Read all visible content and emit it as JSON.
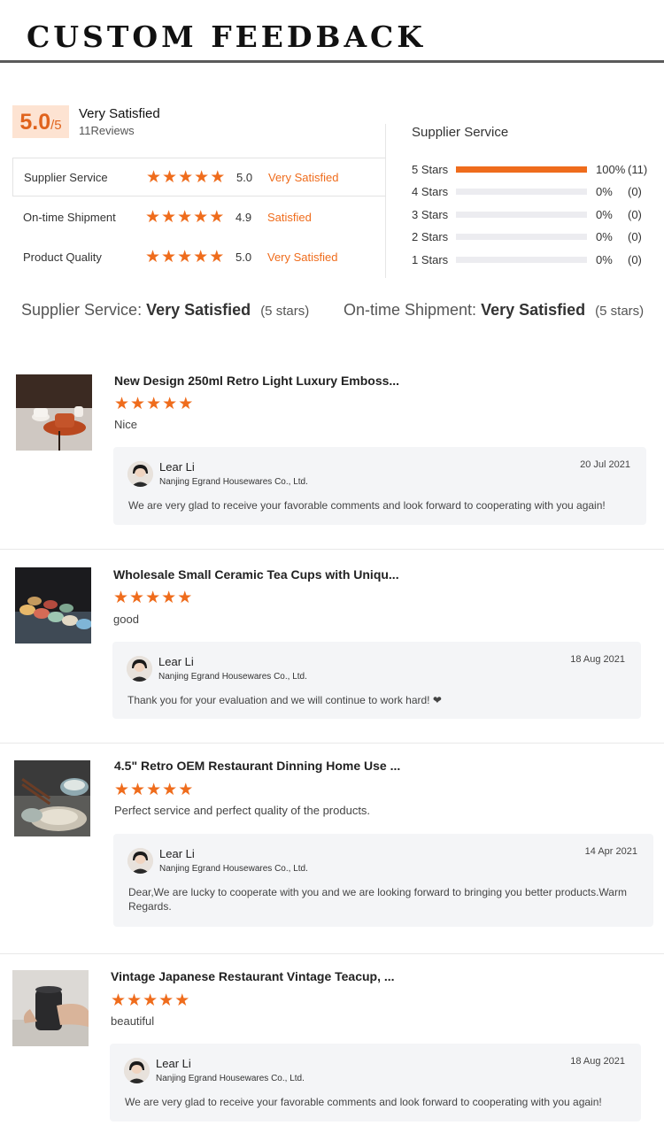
{
  "header": {
    "title": "CUSTOM  FEEDBACK"
  },
  "summary": {
    "score": "5.0",
    "score_max": "/5",
    "label": "Very Satisfied",
    "reviews_count": "11Reviews"
  },
  "ratings": [
    {
      "label": "Supplier Service",
      "stars": 5,
      "score": "5.0",
      "verdict": "Very Satisfied"
    },
    {
      "label": "On-time Shipment",
      "stars": 5,
      "score": "4.9",
      "verdict": "Satisfied"
    },
    {
      "label": "Product Quality",
      "stars": 5,
      "score": "5.0",
      "verdict": "Very Satisfied"
    }
  ],
  "distribution": {
    "title": "Supplier Service",
    "rows": [
      {
        "label": "5  Stars",
        "fraction": 1.0,
        "pct": "100%",
        "count": "(11)"
      },
      {
        "label": "4  Stars",
        "fraction": 0,
        "pct": "0%",
        "count": "(0)"
      },
      {
        "label": "3  Stars",
        "fraction": 0,
        "pct": "0%",
        "count": "(0)"
      },
      {
        "label": "2  Stars",
        "fraction": 0,
        "pct": "0%",
        "count": "(0)"
      },
      {
        "label": "1  Stars",
        "fraction": 0,
        "pct": "0%",
        "count": "(0)"
      }
    ]
  },
  "service_lines": [
    {
      "label": "Supplier Service:",
      "value": "Very Satisfied",
      "note": "(5 stars)"
    },
    {
      "label": "On-time Shipment:",
      "value": "Very Satisfied",
      "note": "(5 stars)"
    }
  ],
  "reviews": [
    {
      "product": "New Design 250ml Retro Light Luxury Emboss...",
      "stars": 5,
      "comment": "Nice",
      "reply": {
        "name": "Lear Li",
        "company": "Nanjing Egrand Housewares Co., Ltd.",
        "date": "20 Jul 2021",
        "text": "We are very glad to receive your favorable comments and look forward to cooperating with you again!"
      }
    },
    {
      "product": "Wholesale Small Ceramic Tea Cups with Uniqu...",
      "stars": 5,
      "comment": "good",
      "reply": {
        "name": "Lear Li",
        "company": "Nanjing Egrand Housewares Co., Ltd.",
        "date": "18 Aug 2021",
        "text": "Thank you for your evaluation and we will continue to work hard! ❤"
      }
    },
    {
      "product": "4.5\" Retro OEM Restaurant Dinning Home Use ...",
      "stars": 5,
      "comment": "Perfect service and perfect quality of the products.",
      "reply": {
        "name": "Lear Li",
        "company": "Nanjing Egrand Housewares Co., Ltd.",
        "date": "14 Apr 2021",
        "text": "Dear,We are lucky to cooperate with you and we are looking forward to bringing you better products.Warm Regards."
      }
    },
    {
      "product": "Vintage Japanese Restaurant Vintage Teacup, ...",
      "stars": 5,
      "comment": "beautiful",
      "reply": {
        "name": "Lear Li",
        "company": "Nanjing Egrand Housewares Co., Ltd.",
        "date": "18 Aug 2021",
        "text": "We are very glad to receive your favorable comments and look forward to cooperating with you again!"
      }
    }
  ],
  "colors": {
    "accent": "#ef6c1c",
    "badge_bg": "#fde3d2",
    "reply_bg": "#f4f5f7"
  },
  "icons": {
    "star": "star-icon"
  }
}
